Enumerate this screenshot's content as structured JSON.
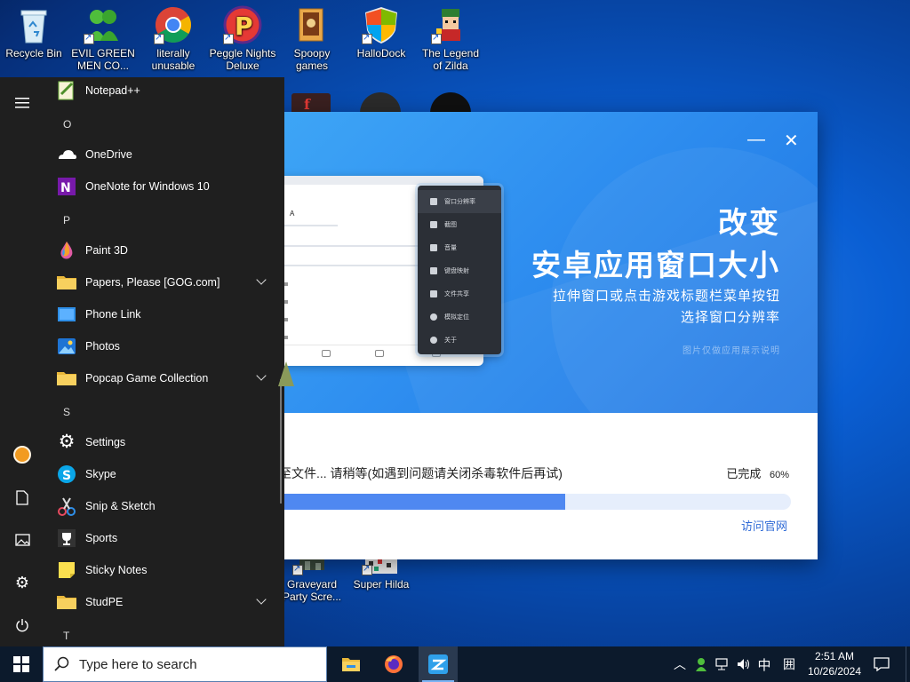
{
  "desktop": {
    "icons": [
      {
        "label": "Recycle Bin"
      },
      {
        "label": "EVIL GREEN MEN CO..."
      },
      {
        "label": "literally unusable"
      },
      {
        "label": "Peggle Nights Deluxe"
      },
      {
        "label": "Spoopy games"
      },
      {
        "label": "HalloDock"
      },
      {
        "label": "The Legend of Zilda"
      },
      {
        "label": "Graveyard Party Scre..."
      },
      {
        "label": "Super Hilda"
      }
    ]
  },
  "installer": {
    "title_line1": "改变",
    "title_line2": "安卓应用窗口大小",
    "subtitle_line1": "拉伸窗口或点击游戏标题栏菜单按钮",
    "subtitle_line2": "选择窗口分辨率",
    "note": "图片仅做应用展示说明",
    "mock_header_letter": "A",
    "mock_menu": [
      "窗口分辨率",
      "截图",
      "音量",
      "键盘映射",
      "文件共享",
      "模拟定位",
      "关于"
    ],
    "status_text": "正在安装文件... 请稍等(如遇到问题请关闭杀毒软件后再试)",
    "status_visible": "至文件... 请稍等(如遇到问题请关闭杀毒软件后再试)",
    "done_label": "已完成",
    "progress_label": "60%",
    "progress": 0.6,
    "link_label": "访问官网",
    "minimize_glyph": "—",
    "close_glyph": "✕"
  },
  "start_menu": {
    "entries": [
      {
        "kind": "app",
        "label": "Notepad++",
        "icon": "notepadpp-icon"
      },
      {
        "kind": "letter",
        "label": "O"
      },
      {
        "kind": "app",
        "label": "OneDrive",
        "icon": "onedrive-icon"
      },
      {
        "kind": "app",
        "label": "OneNote for Windows 10",
        "icon": "onenote-icon"
      },
      {
        "kind": "letter",
        "label": "P"
      },
      {
        "kind": "app",
        "label": "Paint 3D",
        "icon": "paint3d-icon"
      },
      {
        "kind": "folder",
        "label": "Papers, Please [GOG.com]",
        "icon": "folder-icon"
      },
      {
        "kind": "app",
        "label": "Phone Link",
        "icon": "phone-link-icon"
      },
      {
        "kind": "app",
        "label": "Photos",
        "icon": "photos-icon"
      },
      {
        "kind": "folder",
        "label": "Popcap Game Collection",
        "icon": "folder-icon"
      },
      {
        "kind": "letter",
        "label": "S"
      },
      {
        "kind": "app",
        "label": "Settings",
        "icon": "gear-icon"
      },
      {
        "kind": "app",
        "label": "Skype",
        "icon": "skype-icon"
      },
      {
        "kind": "app",
        "label": "Snip & Sketch",
        "icon": "snip-icon"
      },
      {
        "kind": "app",
        "label": "Sports",
        "icon": "trophy-icon"
      },
      {
        "kind": "app",
        "label": "Sticky Notes",
        "icon": "sticky-notes-icon"
      },
      {
        "kind": "folder",
        "label": "StudPE",
        "icon": "folder-icon"
      },
      {
        "kind": "letter",
        "label": "T"
      }
    ],
    "rail": [
      "hamburger-icon",
      "user-avatar-icon",
      "documents-icon",
      "pictures-icon",
      "settings-gear-icon",
      "power-icon"
    ]
  },
  "taskbar": {
    "search_placeholder": "Type here to search",
    "apps": [
      "file-explorer-icon",
      "firefox-icon",
      "installer-app-icon"
    ],
    "tray_ime": "中",
    "tray_layout": "囲",
    "time": "2:51 AM",
    "date": "10/26/2024"
  }
}
